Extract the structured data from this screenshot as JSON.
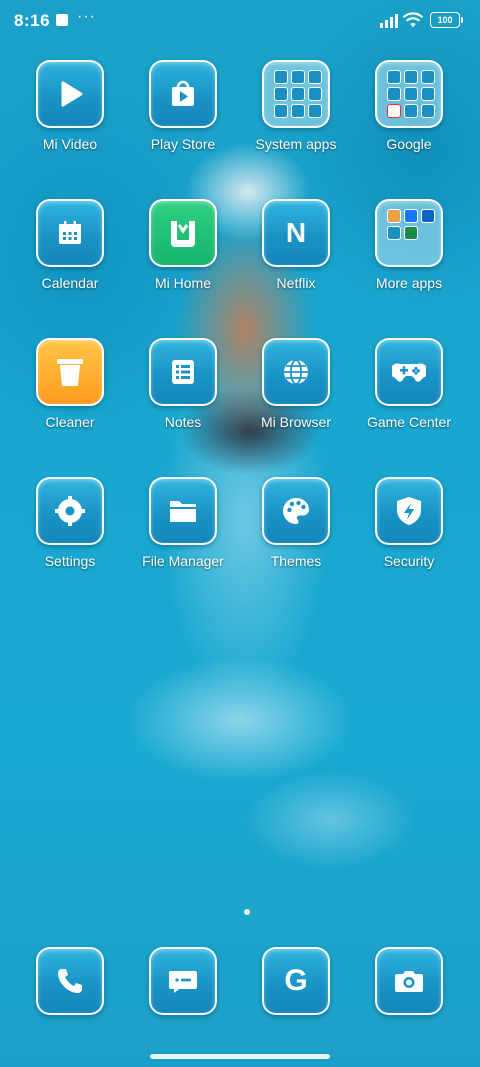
{
  "status_bar": {
    "time": "8:16",
    "more_indicator": "···",
    "battery": "100"
  },
  "home": {
    "apps": [
      {
        "label": "Mi Video",
        "icon": "play-icon"
      },
      {
        "label": "Play Store",
        "icon": "play-store-icon"
      },
      {
        "label": "System apps",
        "icon": "folder-icon"
      },
      {
        "label": "Google",
        "icon": "folder-icon"
      },
      {
        "label": "Calendar",
        "icon": "calendar-icon"
      },
      {
        "label": "Mi Home",
        "icon": "mi-home-icon"
      },
      {
        "label": "Netflix",
        "icon": "netflix-icon",
        "glyph": "N"
      },
      {
        "label": "More apps",
        "icon": "folder-icon"
      },
      {
        "label": "Cleaner",
        "icon": "trash-icon"
      },
      {
        "label": "Notes",
        "icon": "notes-icon"
      },
      {
        "label": "Mi Browser",
        "icon": "globe-icon"
      },
      {
        "label": "Game Center",
        "icon": "gamepad-icon"
      },
      {
        "label": "Settings",
        "icon": "gear-icon"
      },
      {
        "label": "File Manager",
        "icon": "folder-file-icon"
      },
      {
        "label": "Themes",
        "icon": "palette-icon"
      },
      {
        "label": "Security",
        "icon": "shield-icon"
      }
    ]
  },
  "dock": {
    "apps": [
      {
        "name": "Phone",
        "icon": "phone-icon"
      },
      {
        "name": "Messages",
        "icon": "message-icon"
      },
      {
        "name": "Google",
        "icon": "google-icon",
        "glyph": "G"
      },
      {
        "name": "Camera",
        "icon": "camera-icon"
      }
    ]
  },
  "colors": {
    "water": "#1aa6cf",
    "icon_fill": "#1a93c6",
    "mi_home": "#17b46c",
    "cleaner": "#ff9c1e"
  }
}
